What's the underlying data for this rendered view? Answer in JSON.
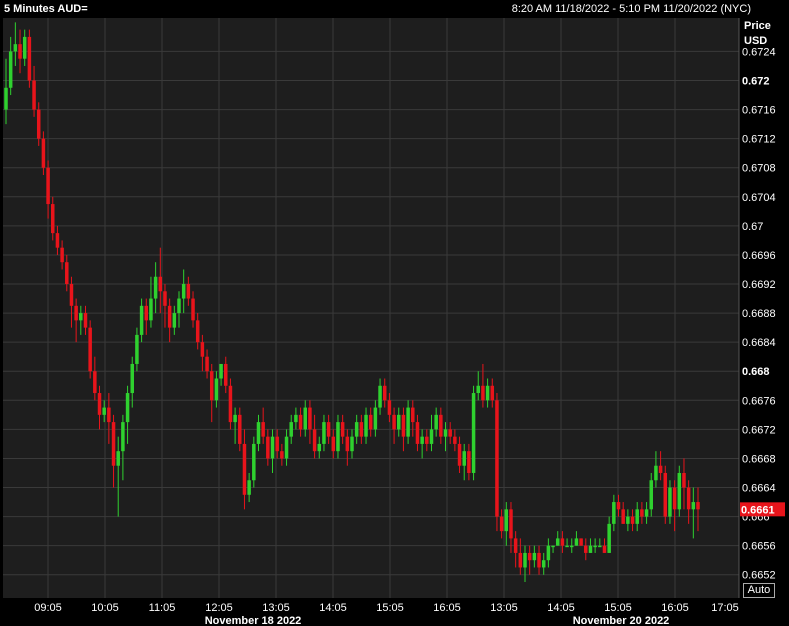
{
  "header": {
    "title": "5 Minutes AUD=",
    "range": "8:20 AM 11/18/2022 - 5:10 PM 11/20/2022 (NYC)"
  },
  "auto_label": "Auto",
  "colors": {
    "up": "#2fd12f",
    "down": "#e8141b",
    "grid": "#3a3a3a",
    "plot_bg": "#1e1e1e",
    "badge": "#e8141b"
  },
  "chart_data": {
    "type": "candlestick",
    "ylabel": [
      "Price",
      "USD"
    ],
    "ylim": [
      0.66488,
      0.67286
    ],
    "yticks": [
      {
        "v": 0.6724,
        "label": "0.6724"
      },
      {
        "v": 0.672,
        "label": "0.672",
        "bold": true
      },
      {
        "v": 0.6716,
        "label": "0.6716"
      },
      {
        "v": 0.6712,
        "label": "0.6712"
      },
      {
        "v": 0.6708,
        "label": "0.6708"
      },
      {
        "v": 0.6704,
        "label": "0.6704"
      },
      {
        "v": 0.67,
        "label": "0.67"
      },
      {
        "v": 0.6696,
        "label": "0.6696"
      },
      {
        "v": 0.6692,
        "label": "0.6692"
      },
      {
        "v": 0.6688,
        "label": "0.6688"
      },
      {
        "v": 0.6684,
        "label": "0.6684"
      },
      {
        "v": 0.668,
        "label": "0.668",
        "bold": true
      },
      {
        "v": 0.6676,
        "label": "0.6676"
      },
      {
        "v": 0.6672,
        "label": "0.6672"
      },
      {
        "v": 0.6668,
        "label": "0.6668"
      },
      {
        "v": 0.6664,
        "label": "0.6664"
      },
      {
        "v": 0.666,
        "label": "0.666"
      },
      {
        "v": 0.6656,
        "label": "0.6656"
      },
      {
        "v": 0.6652,
        "label": "0.6652"
      }
    ],
    "xticks": [
      "09:05",
      "10:05",
      "11:05",
      "12:05",
      "13:05",
      "14:05",
      "15:05",
      "16:05",
      "13:05",
      "14:05",
      "15:05",
      "16:05",
      "17:05"
    ],
    "date_labels": [
      "November 18 2022",
      "November 20 2022"
    ],
    "last_price": "0.6661",
    "last_value": 0.6661,
    "candles": [
      [
        0.6716,
        0.6719,
        0.6714,
        0.6723
      ],
      [
        0.6719,
        0.6724,
        0.6718,
        0.6726
      ],
      [
        0.6724,
        0.6725,
        0.6722,
        0.6728
      ],
      [
        0.6725,
        0.6723,
        0.6721,
        0.6727
      ],
      [
        0.6723,
        0.6726,
        0.6722,
        0.6727
      ],
      [
        0.6726,
        0.672,
        0.6719,
        0.6727
      ],
      [
        0.672,
        0.6716,
        0.6715,
        0.6722
      ],
      [
        0.6716,
        0.6712,
        0.6711,
        0.6717
      ],
      [
        0.6712,
        0.6708,
        0.6707,
        0.6713
      ],
      [
        0.6708,
        0.6703,
        0.6701,
        0.6709
      ],
      [
        0.6703,
        0.6699,
        0.6698,
        0.6704
      ],
      [
        0.6699,
        0.6697,
        0.6696,
        0.67
      ],
      [
        0.6697,
        0.6695,
        0.6694,
        0.6698
      ],
      [
        0.6695,
        0.6692,
        0.6691,
        0.6696
      ],
      [
        0.6692,
        0.6689,
        0.6686,
        0.6693
      ],
      [
        0.6689,
        0.6687,
        0.6684,
        0.669
      ],
      [
        0.6687,
        0.6688,
        0.6685,
        0.6689
      ],
      [
        0.6688,
        0.6686,
        0.6685,
        0.6689
      ],
      [
        0.6686,
        0.668,
        0.6679,
        0.6687
      ],
      [
        0.668,
        0.6677,
        0.6676,
        0.6682
      ],
      [
        0.6677,
        0.6674,
        0.6672,
        0.6678
      ],
      [
        0.6674,
        0.6675,
        0.6673,
        0.6676
      ],
      [
        0.6675,
        0.6673,
        0.667,
        0.6677
      ],
      [
        0.6673,
        0.6667,
        0.6664,
        0.6674
      ],
      [
        0.6667,
        0.6669,
        0.666,
        0.6671
      ],
      [
        0.6669,
        0.6673,
        0.6665,
        0.6674
      ],
      [
        0.6673,
        0.6677,
        0.667,
        0.6678
      ],
      [
        0.6677,
        0.6681,
        0.6675,
        0.6682
      ],
      [
        0.6681,
        0.6685,
        0.668,
        0.6686
      ],
      [
        0.6685,
        0.6689,
        0.6684,
        0.669
      ],
      [
        0.6689,
        0.6687,
        0.6685,
        0.669
      ],
      [
        0.6687,
        0.669,
        0.6686,
        0.6693
      ],
      [
        0.669,
        0.6693,
        0.6688,
        0.6695
      ],
      [
        0.6693,
        0.6691,
        0.6688,
        0.6697
      ],
      [
        0.6691,
        0.6689,
        0.6686,
        0.6692
      ],
      [
        0.6689,
        0.6686,
        0.6684,
        0.669
      ],
      [
        0.6686,
        0.6688,
        0.6685,
        0.6689
      ],
      [
        0.6688,
        0.669,
        0.6686,
        0.6691
      ],
      [
        0.669,
        0.6692,
        0.6688,
        0.6694
      ],
      [
        0.6692,
        0.669,
        0.6689,
        0.6693
      ],
      [
        0.669,
        0.6687,
        0.6686,
        0.6691
      ],
      [
        0.6687,
        0.6684,
        0.6683,
        0.6688
      ],
      [
        0.6684,
        0.6682,
        0.668,
        0.6685
      ],
      [
        0.6682,
        0.668,
        0.6679,
        0.6683
      ],
      [
        0.668,
        0.6676,
        0.6673,
        0.6681
      ],
      [
        0.6676,
        0.6679,
        0.6675,
        0.668
      ],
      [
        0.6679,
        0.6681,
        0.6678,
        0.6681
      ],
      [
        0.6681,
        0.6678,
        0.6677,
        0.6682
      ],
      [
        0.6678,
        0.6673,
        0.6672,
        0.6679
      ],
      [
        0.6673,
        0.6674,
        0.667,
        0.6675
      ],
      [
        0.6674,
        0.667,
        0.6669,
        0.6675
      ],
      [
        0.667,
        0.6663,
        0.6661,
        0.6672
      ],
      [
        0.6663,
        0.6665,
        0.6662,
        0.6666
      ],
      [
        0.6665,
        0.667,
        0.6664,
        0.6671
      ],
      [
        0.667,
        0.6673,
        0.6669,
        0.6674
      ],
      [
        0.6673,
        0.6671,
        0.667,
        0.6675
      ],
      [
        0.6671,
        0.6668,
        0.6667,
        0.6672
      ],
      [
        0.6668,
        0.6671,
        0.6666,
        0.6672
      ],
      [
        0.6671,
        0.6669,
        0.6668,
        0.6672
      ],
      [
        0.6669,
        0.6668,
        0.6667,
        0.667
      ],
      [
        0.6668,
        0.6671,
        0.6667,
        0.6672
      ],
      [
        0.6671,
        0.6673,
        0.667,
        0.6674
      ],
      [
        0.6673,
        0.6674,
        0.6672,
        0.6675
      ],
      [
        0.6674,
        0.6672,
        0.6671,
        0.6675
      ],
      [
        0.6672,
        0.6675,
        0.6671,
        0.6676
      ],
      [
        0.6675,
        0.6672,
        0.667,
        0.6676
      ],
      [
        0.6672,
        0.6669,
        0.6668,
        0.6674
      ],
      [
        0.6669,
        0.667,
        0.6668,
        0.6671
      ],
      [
        0.667,
        0.6673,
        0.6669,
        0.6674
      ],
      [
        0.6673,
        0.6671,
        0.667,
        0.6674
      ],
      [
        0.6671,
        0.6669,
        0.6668,
        0.6672
      ],
      [
        0.6669,
        0.6673,
        0.6668,
        0.6674
      ],
      [
        0.6673,
        0.6671,
        0.667,
        0.6674
      ],
      [
        0.6671,
        0.6669,
        0.6667,
        0.6672
      ],
      [
        0.6669,
        0.6671,
        0.6668,
        0.6672
      ],
      [
        0.6671,
        0.6673,
        0.667,
        0.6674
      ],
      [
        0.6673,
        0.6671,
        0.667,
        0.6674
      ],
      [
        0.6671,
        0.6674,
        0.667,
        0.6675
      ],
      [
        0.6674,
        0.6672,
        0.6671,
        0.6675
      ],
      [
        0.6672,
        0.6675,
        0.6671,
        0.6676
      ],
      [
        0.6675,
        0.6678,
        0.6674,
        0.6679
      ],
      [
        0.6678,
        0.6676,
        0.6675,
        0.6679
      ],
      [
        0.6676,
        0.6674,
        0.6673,
        0.6677
      ],
      [
        0.6674,
        0.6672,
        0.667,
        0.6675
      ],
      [
        0.6672,
        0.6674,
        0.6671,
        0.6675
      ],
      [
        0.6674,
        0.6671,
        0.6669,
        0.6675
      ],
      [
        0.6671,
        0.6675,
        0.667,
        0.6676
      ],
      [
        0.6675,
        0.6673,
        0.6671,
        0.6676
      ],
      [
        0.6673,
        0.667,
        0.6669,
        0.6674
      ],
      [
        0.667,
        0.6671,
        0.6668,
        0.6672
      ],
      [
        0.6671,
        0.667,
        0.6669,
        0.6672
      ],
      [
        0.667,
        0.6672,
        0.6669,
        0.6674
      ],
      [
        0.6672,
        0.6674,
        0.6671,
        0.6675
      ],
      [
        0.6674,
        0.6671,
        0.667,
        0.6675
      ],
      [
        0.6671,
        0.6672,
        0.6669,
        0.6673
      ],
      [
        0.6672,
        0.6671,
        0.667,
        0.6673
      ],
      [
        0.6671,
        0.667,
        0.6669,
        0.6672
      ],
      [
        0.667,
        0.6667,
        0.6666,
        0.6671
      ],
      [
        0.6667,
        0.6669,
        0.6665,
        0.667
      ],
      [
        0.6669,
        0.6666,
        0.6665,
        0.667
      ],
      [
        0.6666,
        0.6677,
        0.6665,
        0.6678
      ],
      [
        0.6677,
        0.6678,
        0.6676,
        0.668
      ],
      [
        0.6678,
        0.6676,
        0.6675,
        0.6681
      ],
      [
        0.6676,
        0.6678,
        0.6675,
        0.6679
      ],
      [
        0.6678,
        0.6676,
        0.6675,
        0.6679
      ],
      [
        0.6676,
        0.666,
        0.6658,
        0.6677
      ],
      [
        0.666,
        0.6658,
        0.6657,
        0.6661
      ],
      [
        0.6658,
        0.6661,
        0.6656,
        0.6662
      ],
      [
        0.6661,
        0.6657,
        0.6655,
        0.6662
      ],
      [
        0.6657,
        0.6655,
        0.6653,
        0.6658
      ],
      [
        0.6655,
        0.6653,
        0.6652,
        0.6657
      ],
      [
        0.6653,
        0.6655,
        0.6651,
        0.6656
      ],
      [
        0.6655,
        0.6654,
        0.6652,
        0.6656
      ],
      [
        0.6654,
        0.6655,
        0.6653,
        0.6656
      ],
      [
        0.6655,
        0.6653,
        0.6652,
        0.6656
      ],
      [
        0.6653,
        0.6654,
        0.6652,
        0.6655
      ],
      [
        0.6654,
        0.6656,
        0.6653,
        0.6657
      ],
      [
        0.6656,
        0.6656,
        0.6655,
        0.6656
      ],
      [
        0.6656,
        0.6657,
        0.6656,
        0.6658
      ],
      [
        0.6657,
        0.6656,
        0.6655,
        0.6658
      ],
      [
        0.6656,
        0.6656,
        0.6656,
        0.6657
      ],
      [
        0.6656,
        0.6656,
        0.6655,
        0.6657
      ],
      [
        0.6656,
        0.6657,
        0.6656,
        0.6658
      ],
      [
        0.6657,
        0.6656,
        0.6656,
        0.6657
      ],
      [
        0.6656,
        0.6655,
        0.6654,
        0.6657
      ],
      [
        0.6655,
        0.6656,
        0.6655,
        0.6657
      ],
      [
        0.6656,
        0.6656,
        0.6655,
        0.6657
      ],
      [
        0.6656,
        0.6656,
        0.6656,
        0.6657
      ],
      [
        0.6656,
        0.6655,
        0.6655,
        0.6657
      ],
      [
        0.6655,
        0.6659,
        0.6655,
        0.666
      ],
      [
        0.6659,
        0.6662,
        0.6658,
        0.6663
      ],
      [
        0.6662,
        0.6661,
        0.666,
        0.6663
      ],
      [
        0.6661,
        0.6659,
        0.6659,
        0.6662
      ],
      [
        0.6659,
        0.666,
        0.6658,
        0.6661
      ],
      [
        0.666,
        0.6659,
        0.6658,
        0.6661
      ],
      [
        0.6659,
        0.6661,
        0.6658,
        0.6662
      ],
      [
        0.6661,
        0.666,
        0.6659,
        0.6662
      ],
      [
        0.666,
        0.6661,
        0.6659,
        0.6662
      ],
      [
        0.6661,
        0.6665,
        0.666,
        0.6666
      ],
      [
        0.6665,
        0.6667,
        0.6664,
        0.6669
      ],
      [
        0.6667,
        0.6666,
        0.6665,
        0.6669
      ],
      [
        0.6666,
        0.666,
        0.6659,
        0.6667
      ],
      [
        0.666,
        0.6664,
        0.6659,
        0.6665
      ],
      [
        0.6664,
        0.6661,
        0.6658,
        0.6665
      ],
      [
        0.6661,
        0.6666,
        0.666,
        0.6667
      ],
      [
        0.6666,
        0.6664,
        0.6661,
        0.6668
      ],
      [
        0.6664,
        0.6661,
        0.6659,
        0.6665
      ],
      [
        0.6661,
        0.6662,
        0.6657,
        0.6664
      ],
      [
        0.6662,
        0.6661,
        0.6658,
        0.6664
      ]
    ]
  }
}
